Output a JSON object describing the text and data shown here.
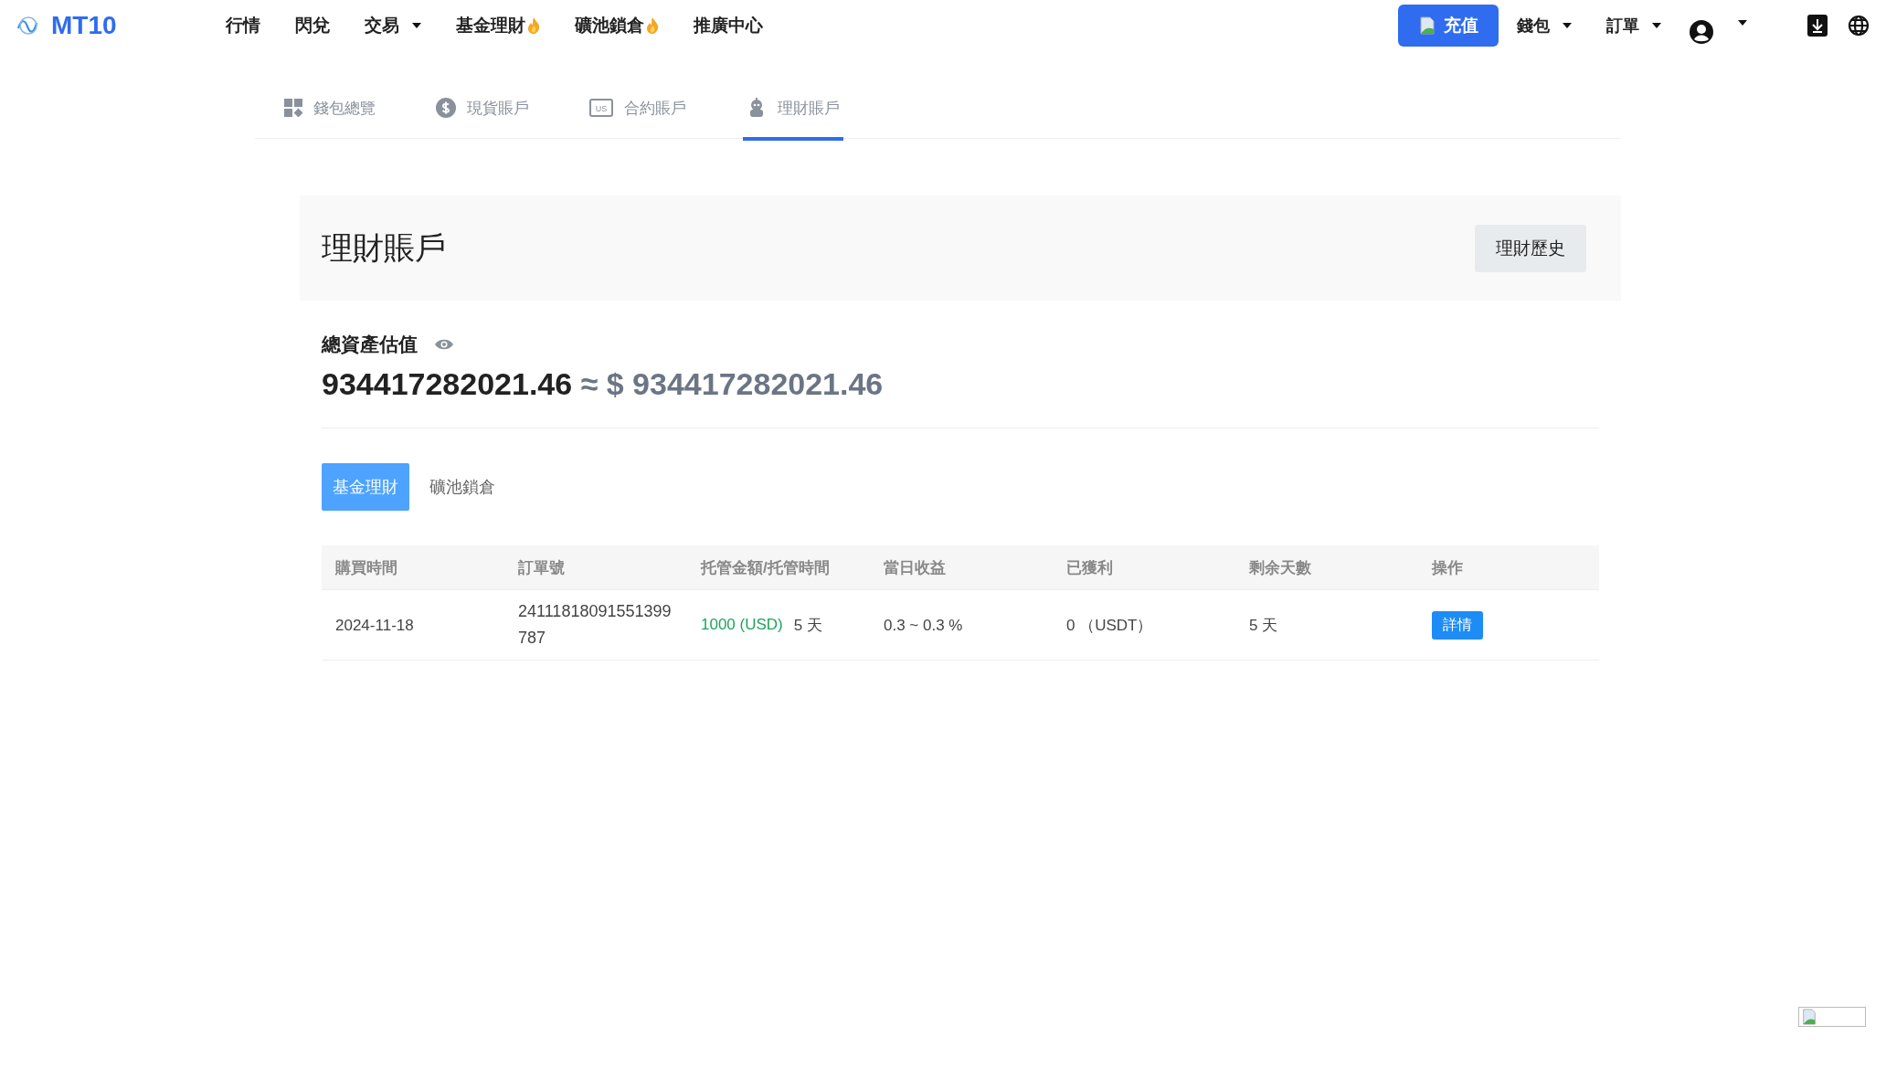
{
  "brand": {
    "name": "MT10"
  },
  "nav": [
    {
      "label": "行情",
      "dropdown": false,
      "hot": false
    },
    {
      "label": "閃兌",
      "dropdown": false,
      "hot": false
    },
    {
      "label": "交易",
      "dropdown": true,
      "hot": false
    },
    {
      "label": "基金理財",
      "dropdown": false,
      "hot": true
    },
    {
      "label": "礦池鎖倉",
      "dropdown": false,
      "hot": true
    },
    {
      "label": "推廣中心",
      "dropdown": false,
      "hot": false
    }
  ],
  "deposit_button": "充值",
  "right_menus": [
    "錢包",
    "訂單"
  ],
  "account_tabs": [
    {
      "label": "錢包總覽",
      "kind": "grid",
      "selected": false
    },
    {
      "label": "現貨賬戶",
      "kind": "dollar",
      "selected": false
    },
    {
      "label": "合約賬戶",
      "kind": "us",
      "badge": "US",
      "selected": false
    },
    {
      "label": "理財賬戶",
      "kind": "robot",
      "selected": true
    }
  ],
  "page_title": "理財賬戶",
  "history_button": "理財歷史",
  "total": {
    "label": "總資產估值",
    "amount": "934417282021.46",
    "approx": "≈ $ 934417282021.46"
  },
  "sub_tabs": [
    {
      "label": "基金理財",
      "selected": true
    },
    {
      "label": "礦池鎖倉",
      "selected": false
    }
  ],
  "table": {
    "columns": [
      "購買時間",
      "訂單號",
      "托管金額/托管時間",
      "當日收益",
      "已獲利",
      "剩余天數",
      "操作"
    ],
    "rows": [
      {
        "date": "2024-11-18",
        "order_no": "24111818091551399787",
        "amount": "1000 (USD)",
        "term": "5 天",
        "daily": "0.3 ~ 0.3 %",
        "profit": "0 （USDT）",
        "days_left": "5 天",
        "action": "詳情"
      }
    ]
  }
}
